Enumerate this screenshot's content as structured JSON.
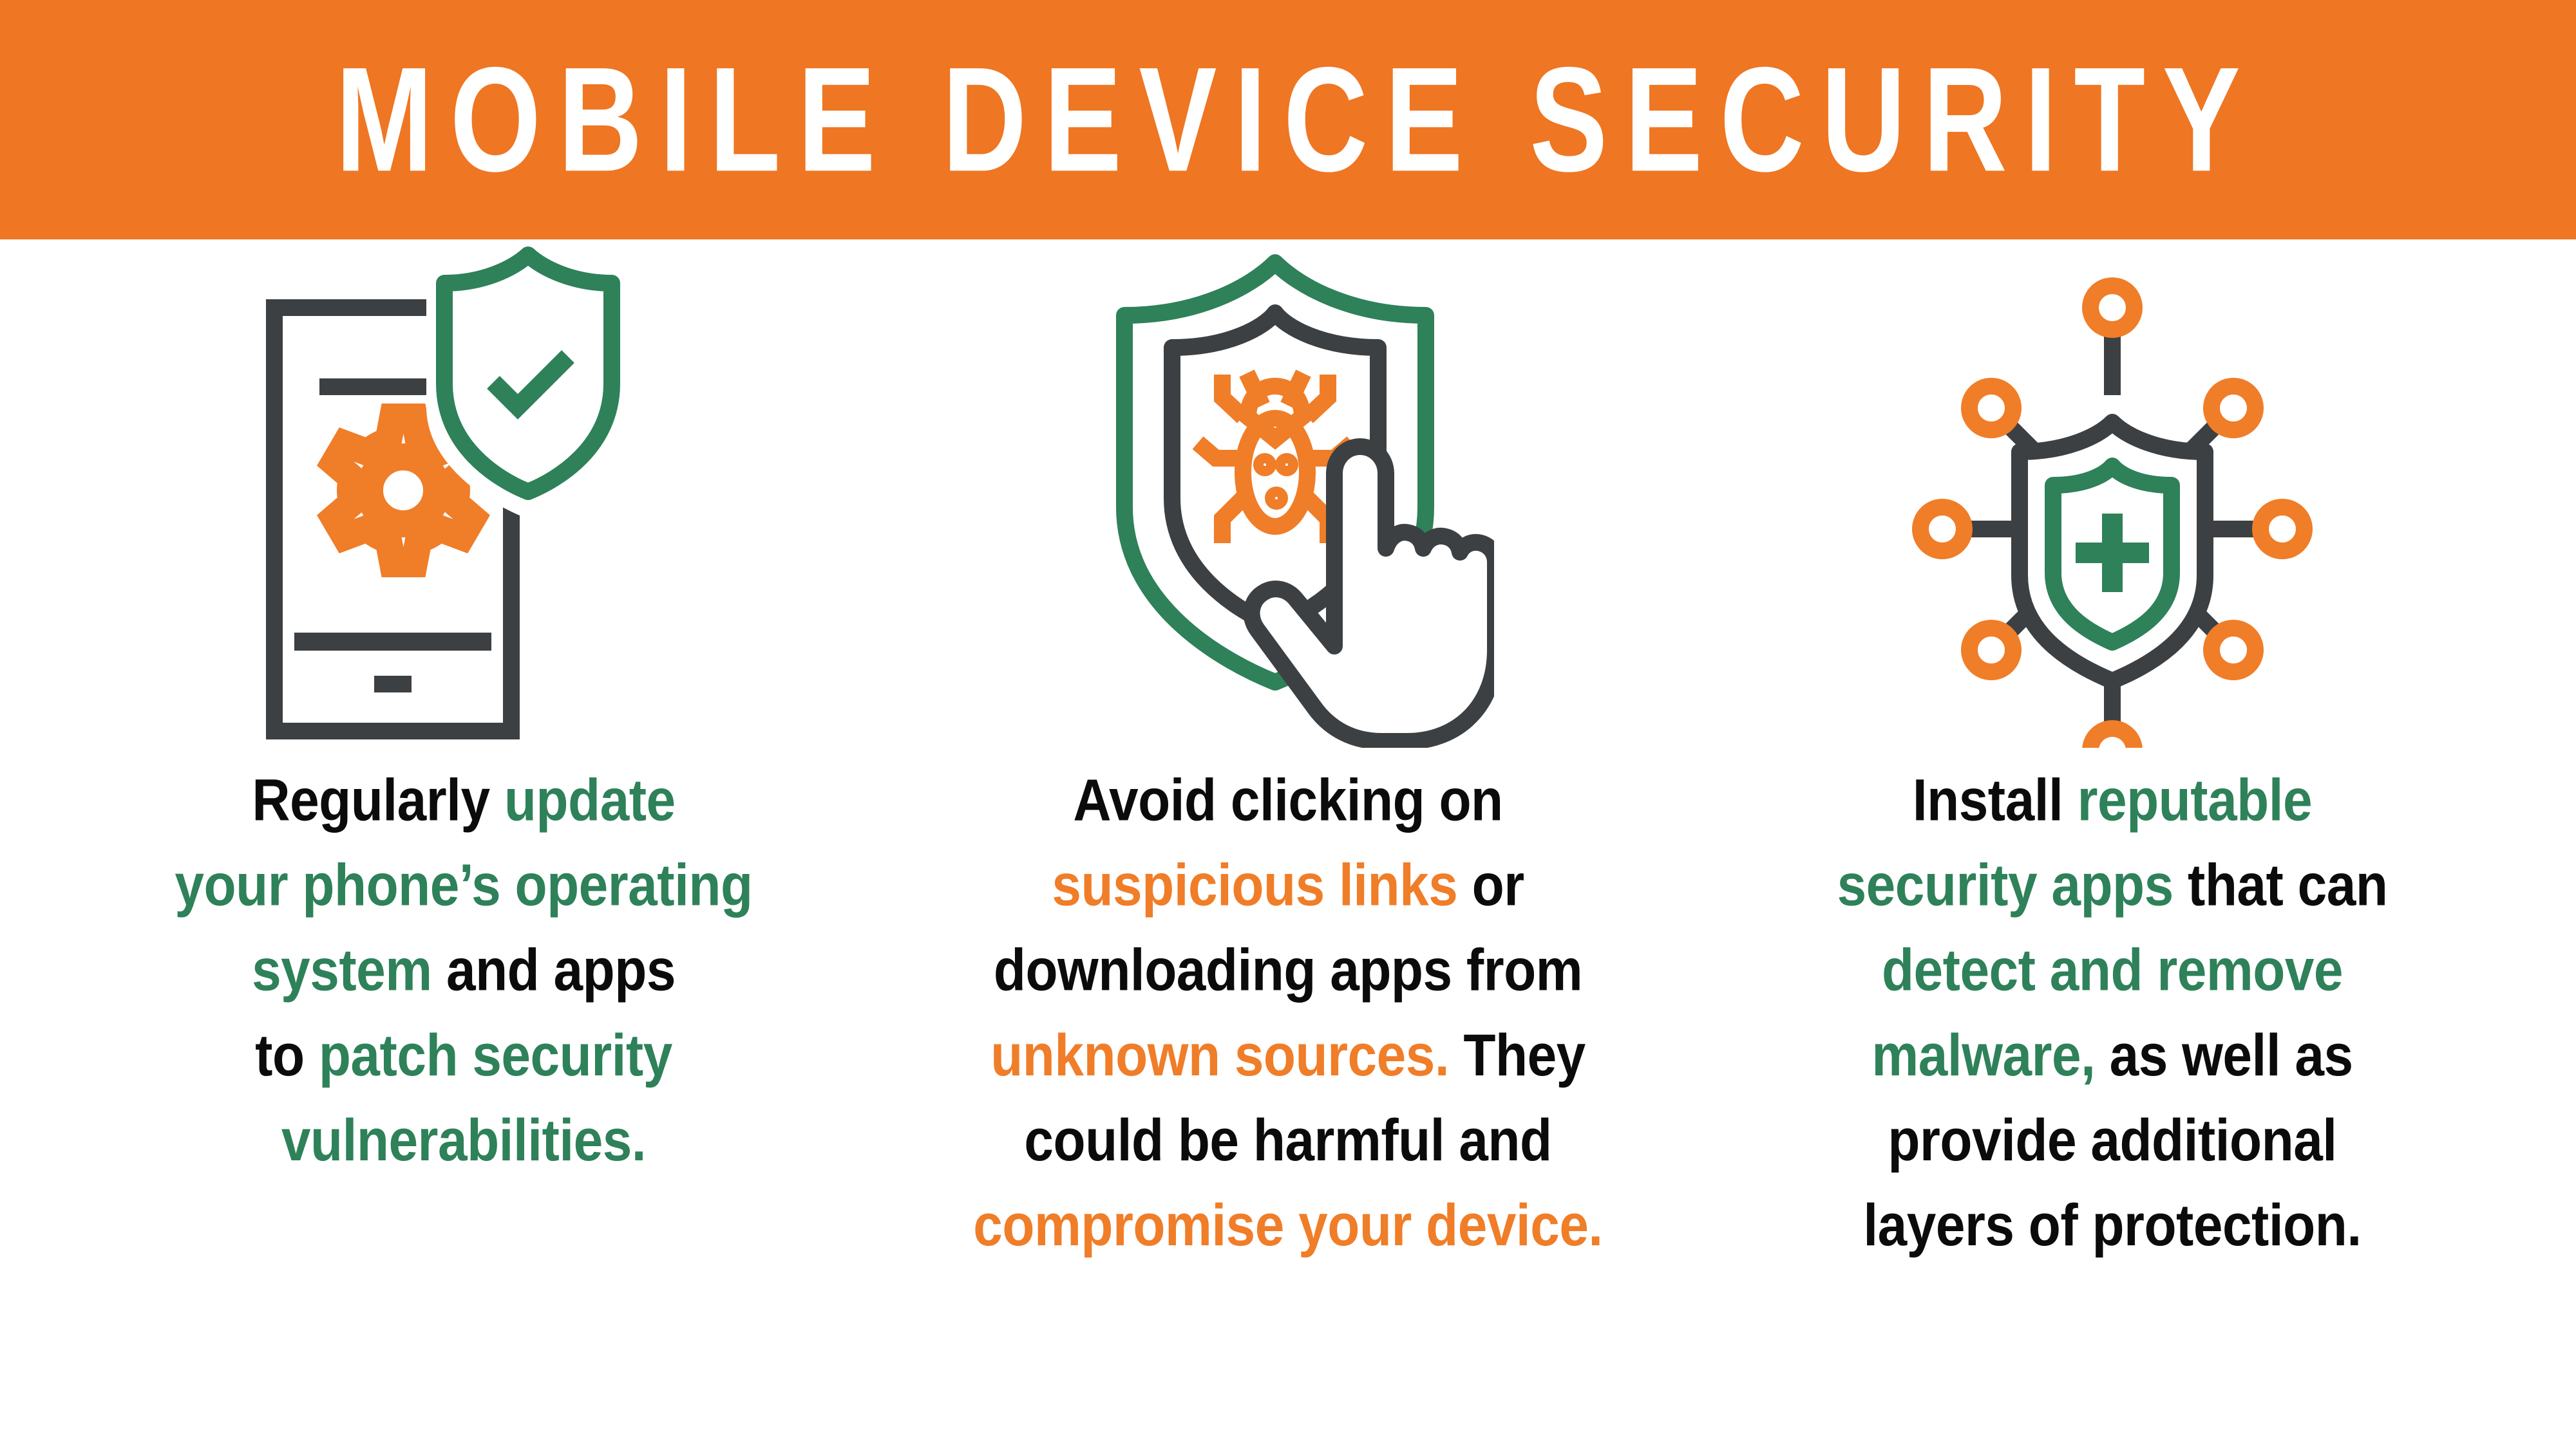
{
  "header": {
    "title": "MOBILE DEVICE SECURITY",
    "background_color": "#ef7622",
    "text_color": "#ffffff"
  },
  "palette": {
    "orange": "#f07d28",
    "header_orange": "#ef7622",
    "green": "#2e8159",
    "dark": "#3c4043",
    "black": "#0b0b0b",
    "white": "#ffffff"
  },
  "columns": [
    {
      "icon": {
        "name": "phone-gear-shield-check-icon",
        "parts": [
          "smartphone-outline",
          "gear",
          "shield",
          "checkmark"
        ]
      },
      "caption_lines": [
        [
          {
            "text": "Regularly ",
            "color": "black"
          },
          {
            "text": "update",
            "color": "green"
          }
        ],
        [
          {
            "text": "your phone’s operating",
            "color": "green"
          }
        ],
        [
          {
            "text": "system",
            "color": "green"
          },
          {
            "text": " and apps",
            "color": "black"
          }
        ],
        [
          {
            "text": "to ",
            "color": "black"
          },
          {
            "text": "patch security",
            "color": "green"
          }
        ],
        [
          {
            "text": "vulnerabilities.",
            "color": "green"
          }
        ]
      ],
      "caption_plain": "Regularly update your phone’s operating system and apps to patch security vulnerabilities."
    },
    {
      "icon": {
        "name": "shield-bug-hand-icon",
        "parts": [
          "outer-shield",
          "inner-shield",
          "bug",
          "pointing-hand-cursor"
        ]
      },
      "caption_lines": [
        [
          {
            "text": "Avoid clicking on",
            "color": "black"
          }
        ],
        [
          {
            "text": "suspicious links",
            "color": "orange"
          },
          {
            "text": " or",
            "color": "black"
          }
        ],
        [
          {
            "text": "downloading apps from",
            "color": "black"
          }
        ],
        [
          {
            "text": "unknown sources.",
            "color": "orange"
          },
          {
            "text": " They",
            "color": "black"
          }
        ],
        [
          {
            "text": "could be harmful and",
            "color": "black"
          }
        ],
        [
          {
            "text": "compromise your device.",
            "color": "orange"
          }
        ]
      ],
      "caption_plain": "Avoid clicking on suspicious links or downloading apps from unknown sources. They could be harmful and compromise your device."
    },
    {
      "icon": {
        "name": "shield-network-nodes-icon",
        "parts": [
          "outer-shield",
          "inner-shield",
          "plus-cross",
          "eight-node-network"
        ]
      },
      "caption_lines": [
        [
          {
            "text": "Install ",
            "color": "black"
          },
          {
            "text": "reputable",
            "color": "green"
          }
        ],
        [
          {
            "text": "security apps",
            "color": "green"
          },
          {
            "text": " that can",
            "color": "black"
          }
        ],
        [
          {
            "text": "detect and remove",
            "color": "green"
          }
        ],
        [
          {
            "text": "malware,",
            "color": "green"
          },
          {
            "text": " as well as",
            "color": "black"
          }
        ],
        [
          {
            "text": "provide additional",
            "color": "black"
          }
        ],
        [
          {
            "text": "layers of protection.",
            "color": "black"
          }
        ]
      ],
      "caption_plain": "Install reputable security apps that can detect and remove malware, as well as provide additional layers of protection."
    }
  ]
}
